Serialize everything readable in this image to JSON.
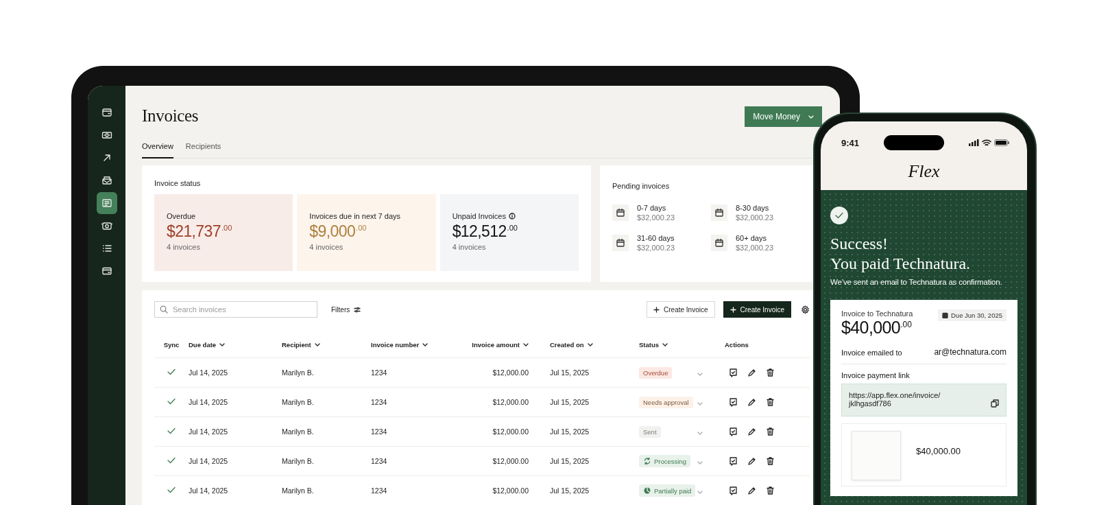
{
  "sidebar": {
    "items": [
      {
        "selected": false
      },
      {
        "selected": false
      },
      {
        "selected": false
      },
      {
        "selected": false
      },
      {
        "selected": true
      },
      {
        "selected": false
      },
      {
        "selected": false
      },
      {
        "selected": false
      }
    ]
  },
  "header": {
    "title": "Invoices",
    "action": "Move Money"
  },
  "tabs": [
    {
      "label": "Overview",
      "selected": true
    },
    {
      "label": "Recipients",
      "selected": false
    }
  ],
  "invoice_status": {
    "title": "Invoice status",
    "cards": [
      {
        "kind": "overdue",
        "label": "Overdue",
        "amount": "$21,737",
        "cents": ".00",
        "note": "4 invoices",
        "info": false
      },
      {
        "kind": "due_soon",
        "label": "Invoices due in next 7 days",
        "amount": "$9,000",
        "cents": ".00",
        "note": "4 invoices",
        "info": false
      },
      {
        "kind": "unpaid",
        "label": "Unpaid Invoices",
        "amount": "$12,512",
        "cents": ".00",
        "note": "4 invoices",
        "info": true
      }
    ]
  },
  "pending_invoices": {
    "title": "Pending invoices",
    "buckets": [
      {
        "label": "0-7 days",
        "amount": "$32,000.23"
      },
      {
        "label": "8-30 days",
        "amount": "$32,000.23"
      },
      {
        "label": "31-60 days",
        "amount": "$32,000.23"
      },
      {
        "label": "60+ days",
        "amount": "$32,000.23"
      }
    ]
  },
  "toolbar": {
    "search_placeholder": "Search invoices",
    "filters": "Filters",
    "buttons": [
      {
        "kind": "secondary",
        "label": "Create Invoice"
      },
      {
        "kind": "primary",
        "label": "Create Invoice"
      }
    ]
  },
  "table": {
    "columns": [
      {
        "label": "Sync",
        "sortable": false
      },
      {
        "label": "Due date",
        "sortable": true
      },
      {
        "label": "Recipient",
        "sortable": true
      },
      {
        "label": "Invoice number",
        "sortable": true
      },
      {
        "label": "Invoice amount",
        "sortable": true
      },
      {
        "label": "Created on",
        "sortable": true
      },
      {
        "label": "Status",
        "sortable": true
      },
      {
        "label": "Actions",
        "sortable": false
      }
    ],
    "rows": [
      {
        "synced": true,
        "due": "Jul 14, 2025",
        "recipient": "Marilyn B.",
        "number": "1234",
        "amount": "$12,000.00",
        "created": "Jul 15, 2025",
        "status": {
          "kind": "overdue",
          "label": "Overdue"
        }
      },
      {
        "synced": true,
        "due": "Jul 14, 2025",
        "recipient": "Marilyn B.",
        "number": "1234",
        "amount": "$12,000.00",
        "created": "Jul 15, 2025",
        "status": {
          "kind": "needs_approval",
          "label": "Needs approval"
        }
      },
      {
        "synced": true,
        "due": "Jul 14, 2025",
        "recipient": "Marilyn B.",
        "number": "1234",
        "amount": "$12,000.00",
        "created": "Jul 15, 2025",
        "status": {
          "kind": "sent",
          "label": "Sent"
        }
      },
      {
        "synced": true,
        "due": "Jul 14, 2025",
        "recipient": "Marilyn B.",
        "number": "1234",
        "amount": "$12,000.00",
        "created": "Jul 15, 2025",
        "status": {
          "kind": "processing",
          "label": "Processing"
        }
      },
      {
        "synced": true,
        "due": "Jul 14, 2025",
        "recipient": "Marilyn B.",
        "number": "1234",
        "amount": "$12,000.00",
        "created": "Jul 15, 2025",
        "status": {
          "kind": "partially_paid",
          "label": "Partially paid"
        }
      }
    ]
  },
  "phone": {
    "time": "9:41",
    "logo": "Flex",
    "heading": [
      "Success!",
      "You paid Technatura."
    ],
    "message": "We’ve sent an email to Technatura as confirmation.",
    "invoice": {
      "title": "Invoice to Technatura",
      "amount": "$40,000",
      "cents": ".00",
      "due": "Due Jun 30, 2025",
      "emailed_label": "Invoice emailed to",
      "email": "ar@technatura.com",
      "link_label": "Invoice payment link",
      "link": "https://app.flex.one/invoice/ jklhgasdf786",
      "preview_amount": "$40,000.00"
    }
  }
}
